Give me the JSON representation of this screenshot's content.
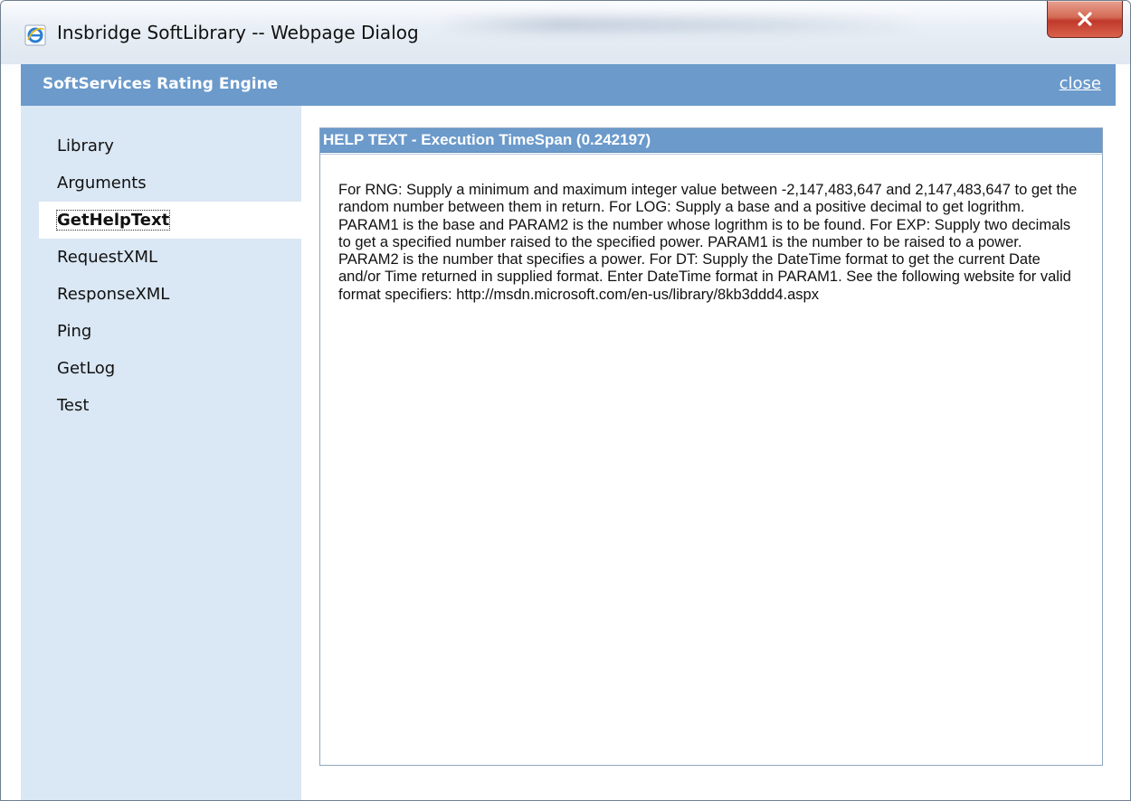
{
  "window": {
    "title": "Insbridge SoftLibrary -- Webpage Dialog",
    "close_glyph": "X",
    "icon": "ie-icon"
  },
  "header": {
    "title": "SoftServices Rating Engine",
    "close_link": "close"
  },
  "sidebar": {
    "items": [
      {
        "label": "Library",
        "active": false
      },
      {
        "label": "Arguments",
        "active": false
      },
      {
        "label": "GetHelpText",
        "active": true
      },
      {
        "label": "RequestXML",
        "active": false
      },
      {
        "label": "ResponseXML",
        "active": false
      },
      {
        "label": "Ping",
        "active": false
      },
      {
        "label": "GetLog",
        "active": false
      },
      {
        "label": "Test",
        "active": false
      }
    ]
  },
  "panel": {
    "title": "HELP TEXT - Execution TimeSpan (0.242197)",
    "body": "For RNG: Supply a minimum and maximum integer value between -2,147,483,647 and 2,147,483,647 to get the random number between them in return. For LOG: Supply a base and a positive decimal to get logrithm. PARAM1 is the base and PARAM2 is the number whose logrithm is to be found. For EXP: Supply two decimals to get a specified number raised to the specified power. PARAM1 is the number to be raised to a power. PARAM2 is the number that specifies a power. For DT: Supply the DateTime format to get the current Date and/or Time returned in supplied format. Enter DateTime format in PARAM1. See the following website for valid format specifiers: http://msdn.microsoft.com/en-us/library/8kb3ddd4.aspx"
  },
  "colors": {
    "header_blue": "#6b9acb",
    "sidebar_bg": "#dae7f4",
    "close_red": "#c0392b"
  }
}
